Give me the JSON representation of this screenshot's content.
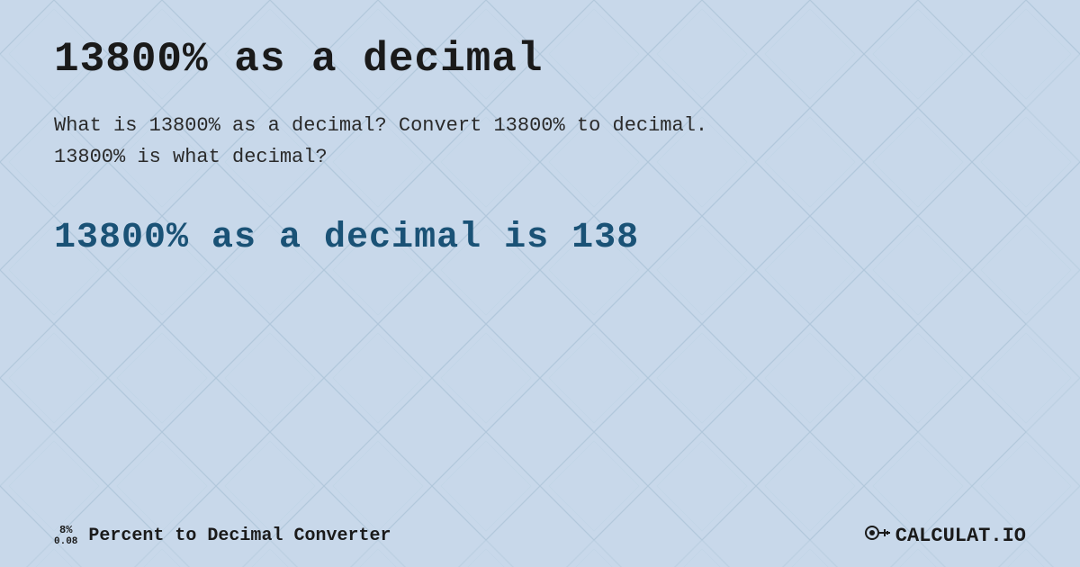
{
  "background": {
    "color": "#c8d8ea"
  },
  "title": "13800% as a decimal",
  "description": {
    "line1": "What is 13800% as a decimal? Convert 13800% to decimal.",
    "line2": "13800% is what decimal?"
  },
  "result": {
    "text": "13800% as a decimal is 138"
  },
  "footer": {
    "percent_top": "8%",
    "percent_bottom": "0.08",
    "label": "Percent to Decimal Converter",
    "logo_text": "CALCULAT.IO"
  }
}
